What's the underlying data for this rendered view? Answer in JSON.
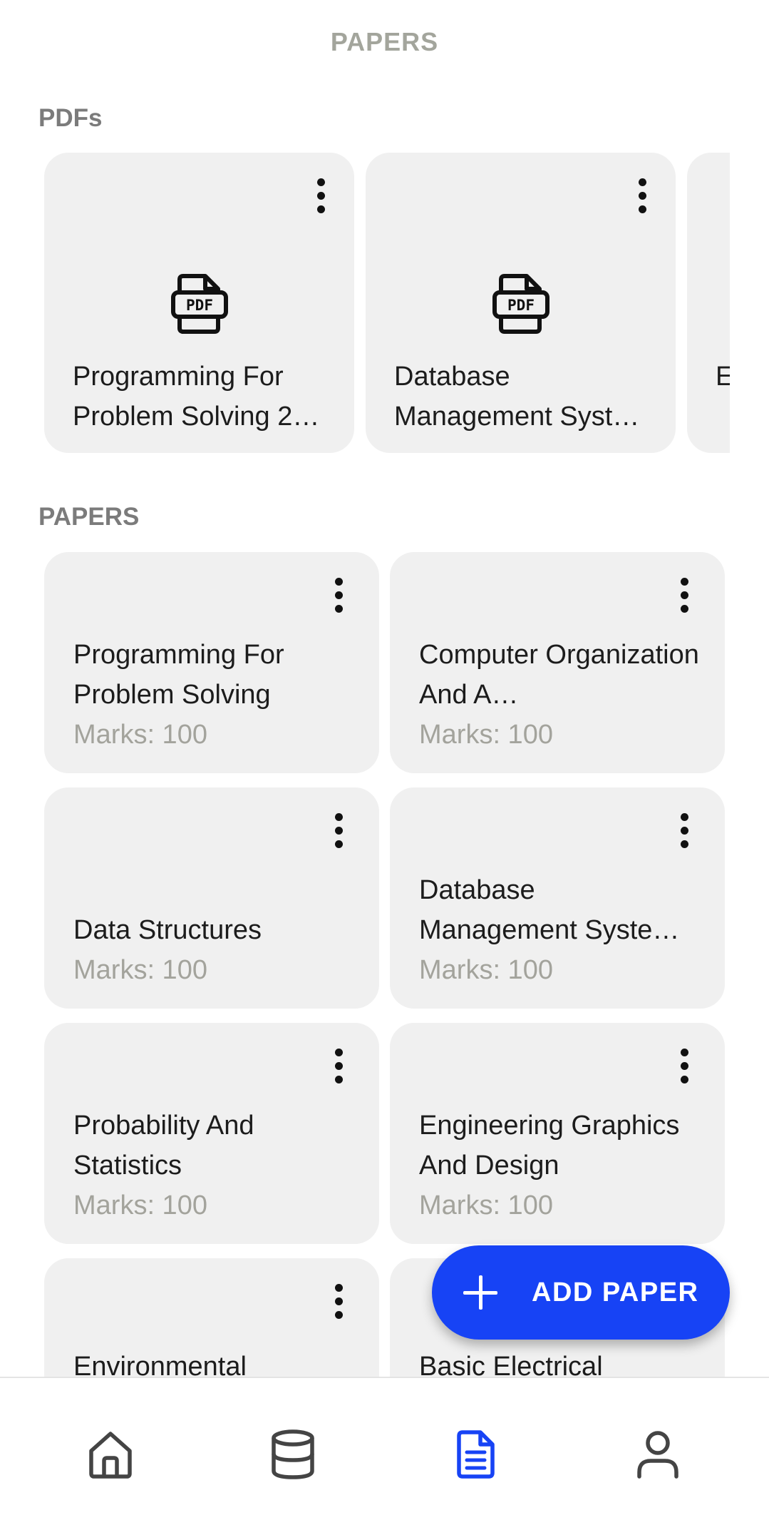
{
  "header": {
    "title": "PAPERS"
  },
  "pdfs": {
    "section_title": "PDFs",
    "items": [
      {
        "title": "Programming For Problem Solving 2…",
        "icon": "pdf-file-icon"
      },
      {
        "title": "Database Management Syst…",
        "icon": "pdf-file-icon"
      },
      {
        "title": "E… S…",
        "icon": "pdf-file-icon"
      }
    ]
  },
  "papers": {
    "section_title": "PAPERS",
    "items": [
      {
        "title": "Programming For Problem Solving",
        "marks": "Marks: 100"
      },
      {
        "title": "Computer Organization And A…",
        "marks": "Marks: 100"
      },
      {
        "title": "Data Structures",
        "marks": "Marks: 100"
      },
      {
        "title": "Database Management Syste…",
        "marks": "Marks: 100"
      },
      {
        "title": "Probability And Statistics",
        "marks": "Marks: 100"
      },
      {
        "title": "Engineering Graphics And Design",
        "marks": "Marks: 100"
      },
      {
        "title": "Environmental"
      },
      {
        "title": "Basic Electrical"
      }
    ]
  },
  "fab": {
    "label": "ADD PAPER",
    "icon": "plus-icon"
  },
  "nav": {
    "items": [
      {
        "icon": "home-icon",
        "active": false
      },
      {
        "icon": "database-icon",
        "active": false
      },
      {
        "icon": "document-icon",
        "active": true
      },
      {
        "icon": "user-icon",
        "active": false
      }
    ]
  },
  "colors": {
    "accent": "#1743f5",
    "card": "#f0f0f0",
    "muted": "#a3a39c",
    "section": "#7b7b7b"
  }
}
